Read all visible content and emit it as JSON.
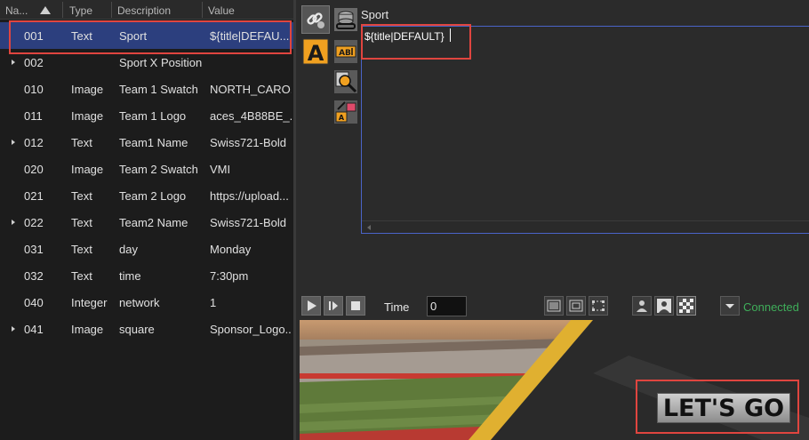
{
  "table": {
    "columns": [
      "Na...",
      "Type",
      "Description",
      "Value"
    ],
    "rows": [
      {
        "name": "001",
        "type": "Text",
        "description": "Sport",
        "value": "${title|DEFAU...",
        "expandable": false,
        "selected": true
      },
      {
        "name": "002",
        "type": "",
        "description": "Sport X Position",
        "value": "",
        "expandable": true,
        "selected": false
      },
      {
        "name": "010",
        "type": "Image",
        "description": "Team 1 Swatch",
        "value": "NORTH_CARO...",
        "expandable": false,
        "selected": false
      },
      {
        "name": "011",
        "type": "Image",
        "description": "Team 1 Logo",
        "value": "aces_4B88BE_...",
        "expandable": false,
        "selected": false
      },
      {
        "name": "012",
        "type": "Text",
        "description": "Team1 Name",
        "value": "Swiss721-Bold",
        "expandable": true,
        "selected": false
      },
      {
        "name": "020",
        "type": "Image",
        "description": "Team 2 Swatch",
        "value": "VMI",
        "expandable": false,
        "selected": false
      },
      {
        "name": "021",
        "type": "Text",
        "description": "Team 2 Logo",
        "value": "https://upload...",
        "expandable": false,
        "selected": false
      },
      {
        "name": "022",
        "type": "Text",
        "description": "Team2 Name",
        "value": "Swiss721-Bold",
        "expandable": true,
        "selected": false
      },
      {
        "name": "031",
        "type": "Text",
        "description": "day",
        "value": "Monday",
        "expandable": false,
        "selected": false
      },
      {
        "name": "032",
        "type": "Text",
        "description": "time",
        "value": "7:30pm",
        "expandable": false,
        "selected": false
      },
      {
        "name": "040",
        "type": "Integer",
        "description": "network",
        "value": "1",
        "expandable": false,
        "selected": false
      },
      {
        "name": "041",
        "type": "Image",
        "description": "square",
        "value": "Sponsor_Logo...",
        "expandable": true,
        "selected": false
      }
    ]
  },
  "property_panel": {
    "label": "Sport",
    "editor_value": "${title|DEFAULT}"
  },
  "tools": [
    {
      "icon": "link-icon"
    },
    {
      "icon": "text-style-icon"
    },
    {
      "icon": "database-link-icon"
    },
    {
      "icon": "text-field-icon"
    },
    {
      "icon": "data-search-icon"
    },
    {
      "icon": "text-edit-tool-icon"
    }
  ],
  "playback": {
    "time_label": "Time",
    "time_value": "0",
    "status": "Connected",
    "buttons": [
      "play-icon",
      "step-icon",
      "stop-icon",
      "layout-1-icon",
      "layout-2-icon",
      "layout-3-icon",
      "person-icon",
      "person-filled-icon",
      "transparency-icon",
      "dropdown-icon"
    ]
  },
  "preview": {
    "overlay_text": "LET'S GO"
  },
  "colors": {
    "selection": "#2c3f7e",
    "highlight": "#e0453f",
    "editor_border": "#4a64c8",
    "status_connected": "#3fae5a",
    "accent_orange": "#f0a020"
  }
}
